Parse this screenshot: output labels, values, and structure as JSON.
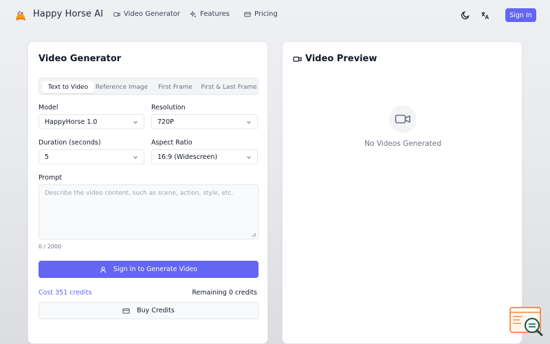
{
  "header": {
    "brand": "Happy Horse AI",
    "nav": [
      {
        "label": "Video Generator",
        "icon": "video-icon"
      },
      {
        "label": "Features",
        "icon": "sparkles-icon"
      },
      {
        "label": "Pricing",
        "icon": "credit-card-icon"
      }
    ],
    "theme_icon": "moon-icon",
    "language_icon": "translate-icon",
    "sign_in": "Sign In"
  },
  "generator": {
    "title": "Video Generator",
    "tabs": [
      "Text to Video",
      "Reference Image",
      "First Frame",
      "First & Last Frame"
    ],
    "active_tab": "Text to Video",
    "model_label": "Model",
    "model_value": "HappyHorse 1.0",
    "resolution_label": "Resolution",
    "resolution_value": "720P",
    "duration_label": "Duration (seconds)",
    "duration_value": "5",
    "aspect_label": "Aspect Ratio",
    "aspect_value": "16:9 (Widescreen)",
    "prompt_label": "Prompt",
    "prompt_placeholder": "Describe the video content, such as scene, action, style, etc.",
    "prompt_counter": "0 / 2000",
    "generate_button": "Sign In to Generate Video",
    "cost": "Cost 351 credits",
    "remaining": "Remaining 0 credits",
    "buy_button": "Buy Credits"
  },
  "preview": {
    "title": "Video Preview",
    "empty_text": "No Videos Generated"
  },
  "colors": {
    "accent": "#6366f1",
    "text": "#111827",
    "muted": "#6b7280",
    "border": "#e5e7eb"
  }
}
